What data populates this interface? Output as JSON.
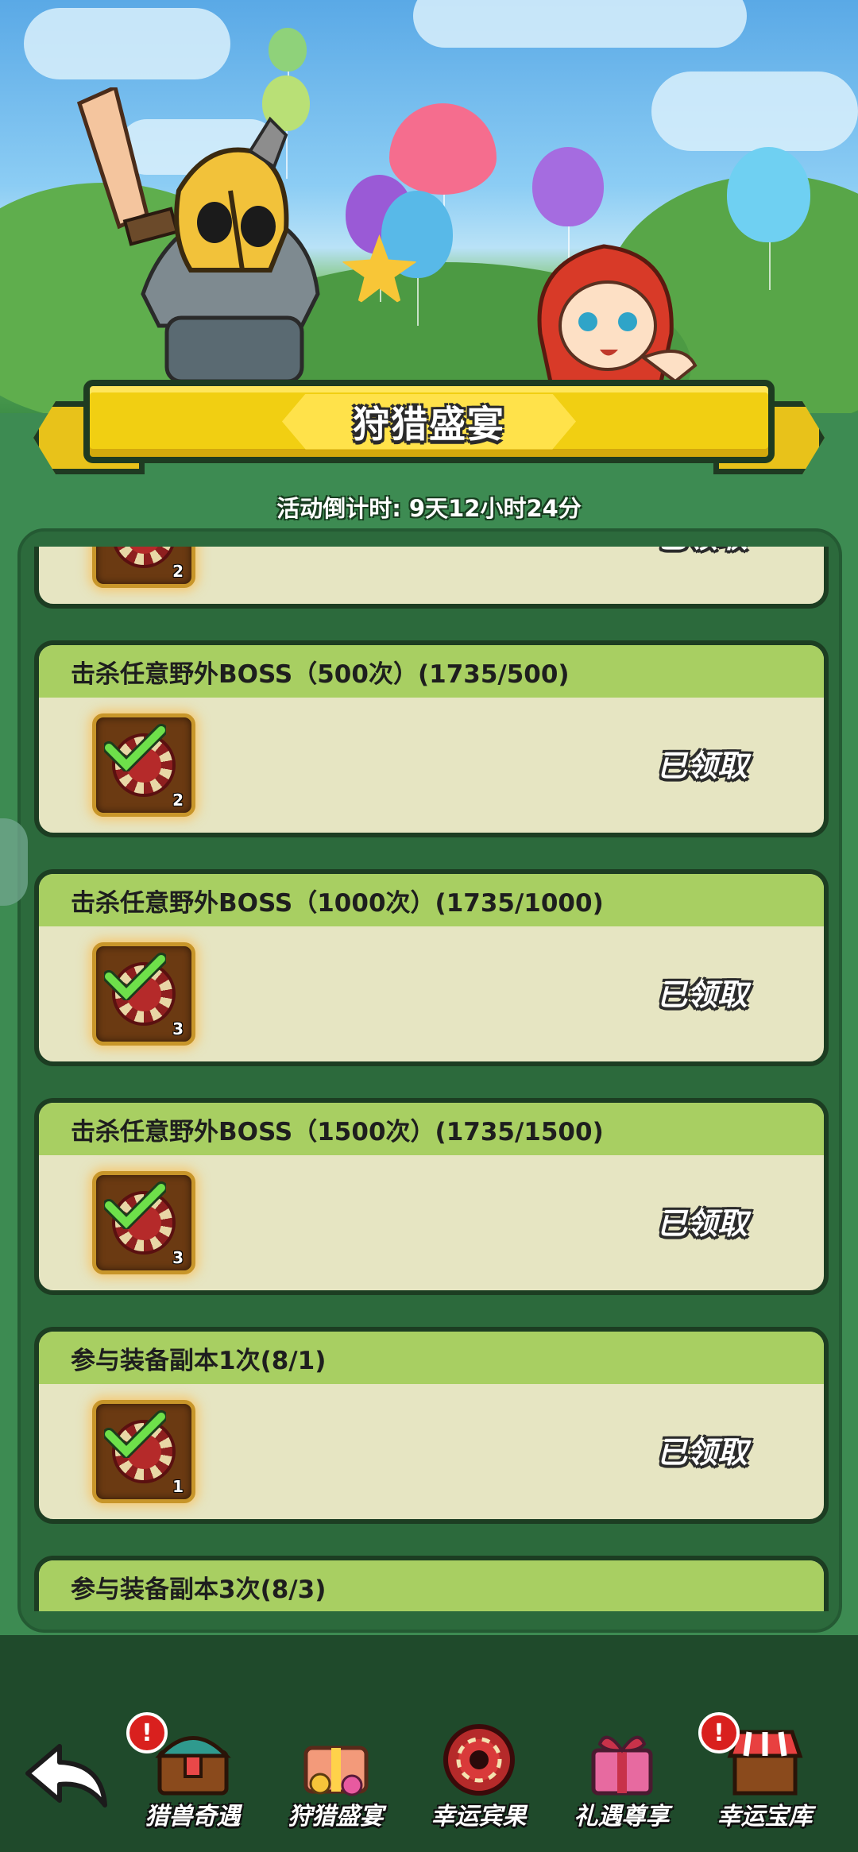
{
  "header": {
    "title": "狩猎盛宴",
    "countdown_label": "活动倒计时:",
    "countdown_value": "9天12小时24分"
  },
  "claimed_label": "已领取",
  "tasks": [
    {
      "title": "",
      "reward_count": "2",
      "status": "已领取"
    },
    {
      "title": "击杀任意野外BOSS（500次）(1735/500)",
      "reward_count": "2",
      "status": "已领取"
    },
    {
      "title": "击杀任意野外BOSS（1000次）(1735/1000)",
      "reward_count": "3",
      "status": "已领取"
    },
    {
      "title": "击杀任意野外BOSS（1500次）(1735/1500)",
      "reward_count": "3",
      "status": "已领取"
    },
    {
      "title": "参与装备副本1次(8/1)",
      "reward_count": "1",
      "status": "已领取"
    },
    {
      "title": "参与装备副本3次(8/3)",
      "reward_count": "",
      "status": ""
    }
  ],
  "nav": [
    {
      "label": "猎兽奇遇",
      "icon": "treasure-chest-icon",
      "badge": "!"
    },
    {
      "label": "狩猎盛宴",
      "icon": "gift-pile-icon",
      "badge": ""
    },
    {
      "label": "幸运宾果",
      "icon": "casino-chip-icon",
      "badge": ""
    },
    {
      "label": "礼遇尊享",
      "icon": "gift-box-icon",
      "badge": ""
    },
    {
      "label": "幸运宝库",
      "icon": "shop-stall-icon",
      "badge": "!"
    }
  ],
  "colors": {
    "card_header": "#a8cf62",
    "card_body": "#e6e5c2",
    "ribbon": "#f1cf12",
    "panel": "#2c6a3c"
  }
}
